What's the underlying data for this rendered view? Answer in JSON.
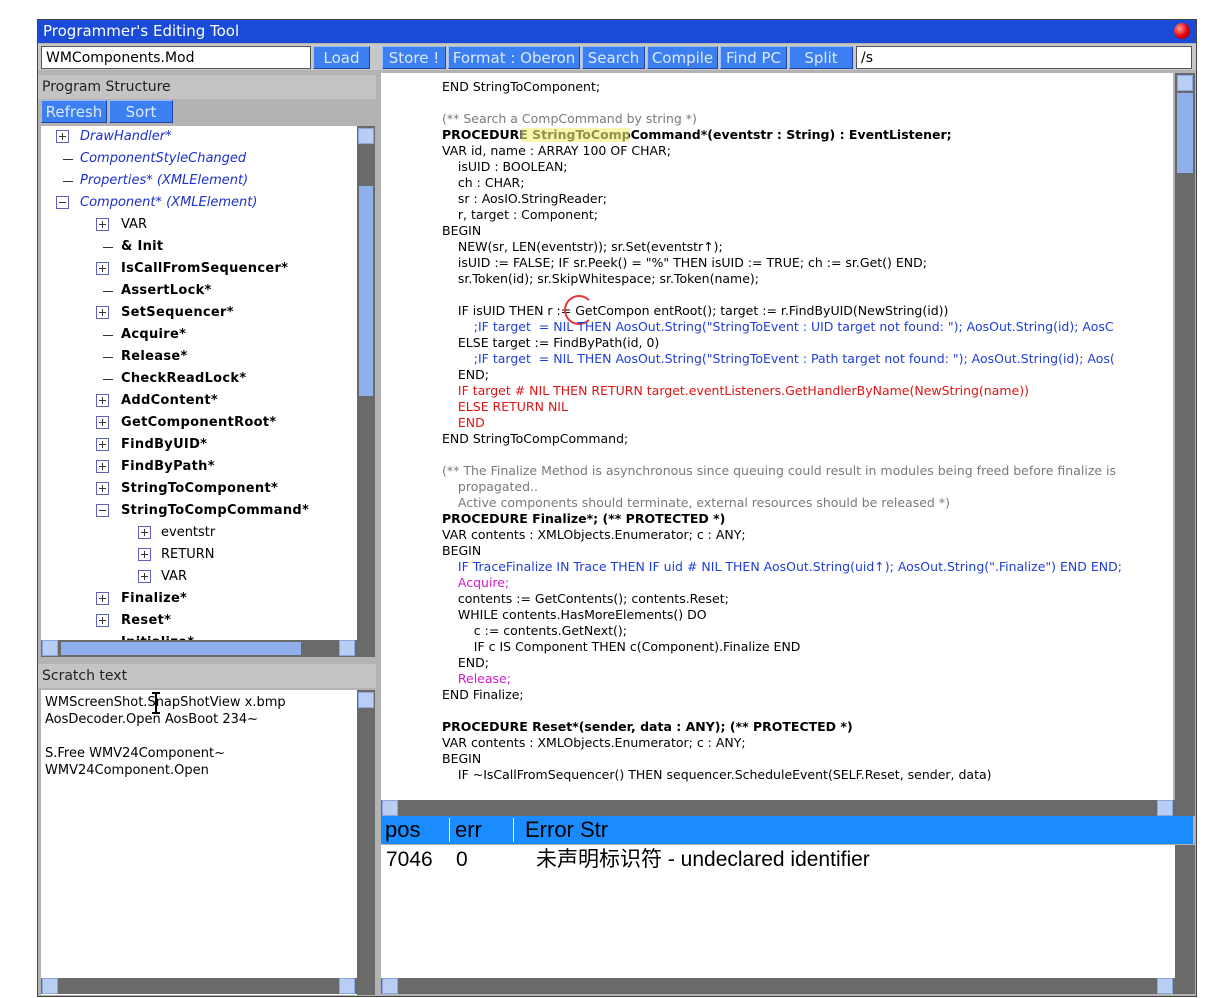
{
  "window": {
    "title": "Programmer's Editing Tool"
  },
  "toolbar": {
    "filename": "WMComponents.Mod",
    "load": "Load",
    "store": "Store !",
    "format": "Format : Oberon",
    "search": "Search",
    "compile": "Compile",
    "find_pc": "Find PC",
    "split": "Split",
    "search_value": "/s"
  },
  "structure": {
    "header": "Program Structure",
    "refresh": "Refresh",
    "sort": "Sort",
    "items": [
      "DrawHandler*",
      "ComponentStyleChanged",
      "Properties* (XMLElement)",
      "Component* (XMLElement)",
      "VAR",
      "& Init",
      "IsCallFromSequencer*",
      "AssertLock*",
      "SetSequencer*",
      "Acquire*",
      "Release*",
      "CheckReadLock*",
      "AddContent*",
      "GetComponentRoot*",
      "FindByUID*",
      "FindByPath*",
      "StringToComponent*",
      "StringToCompCommand*",
      "eventstr",
      "RETURN",
      "VAR",
      "Finalize*",
      "Reset*",
      "Initialize*"
    ]
  },
  "scratch": {
    "header": "Scratch text",
    "lines": [
      "WMScreenShot.SnapShotView x.bmp",
      "AosDecoder.Open AosBoot 234~",
      "",
      "S.Free WMV24Component~",
      "WMV24Component.Open"
    ]
  },
  "code": {
    "lines": [
      "END StringToComponent;",
      "",
      "(** Search a CompCommand by string *)",
      "PROCEDURE StringToCompCommand*(eventstr : String) : EventListener;",
      "VAR id, name : ARRAY 100 OF CHAR;",
      "    isUID : BOOLEAN;",
      "    ch : CHAR;",
      "    sr : AosIO.StringReader;",
      "    r, target : Component;",
      "BEGIN",
      "    NEW(sr, LEN(eventstr)); sr.Set(eventstr↑);",
      "    isUID := FALSE; IF sr.Peek() = \"%\" THEN isUID := TRUE; ch := sr.Get() END;",
      "    sr.Token(id); sr.SkipWhitespace; sr.Token(name);",
      "",
      "    IF isUID THEN r := GetCompon entRoot(); target := r.FindByUID(NewString(id))",
      "        ;IF target  = NIL THEN AosOut.String(\"StringToEvent : UID target not found: \"); AosOut.String(id); AosC",
      "    ELSE target := FindByPath(id, 0)",
      "        ;IF target  = NIL THEN AosOut.String(\"StringToEvent : Path target not found: \"); AosOut.String(id); Aos(",
      "    END;",
      "    IF target # NIL THEN RETURN target.eventListeners.GetHandlerByName(NewString(name))",
      "    ELSE RETURN NIL",
      "    END",
      "END StringToCompCommand;",
      "",
      "(** The Finalize Method is asynchronous since queuing could result in modules being freed before finalize is",
      "    propagated..",
      "    Active components should terminate, external resources should be released *)",
      "PROCEDURE Finalize*; (** PROTECTED *)",
      "VAR contents : XMLObjects.Enumerator; c : ANY;",
      "BEGIN",
      "    IF TraceFinalize IN Trace THEN IF uid # NIL THEN AosOut.String(uid↑); AosOut.String(\".Finalize\") END END;",
      "    Acquire;",
      "    contents := GetContents(); contents.Reset;",
      "    WHILE contents.HasMoreElements() DO",
      "        c := contents.GetNext();",
      "        IF c IS Component THEN c(Component).Finalize END",
      "    END;",
      "    Release;",
      "END Finalize;",
      "",
      "PROCEDURE Reset*(sender, data : ANY); (** PROTECTED *)",
      "VAR contents : XMLObjects.Enumerator; c : ANY;",
      "BEGIN",
      "    IF ~IsCallFromSequencer() THEN sequencer.ScheduleEvent(SELF.Reset, sender, data)"
    ]
  },
  "errors": {
    "headers": {
      "pos": "pos",
      "err": "err",
      "msg": "Error Str"
    },
    "rows": [
      {
        "pos": "7046",
        "err": "0",
        "msg": "未声明标识符 - undeclared identifier"
      }
    ]
  },
  "colors": {
    "title_bar": "#1a4ad8",
    "button": "#3c7ff0",
    "error_header": "#1a8cff",
    "keyword_red": "#e01414",
    "trace_blue": "#1f3ed6",
    "lock_magenta": "#d01ac8",
    "highlight": "#f4f07a"
  }
}
